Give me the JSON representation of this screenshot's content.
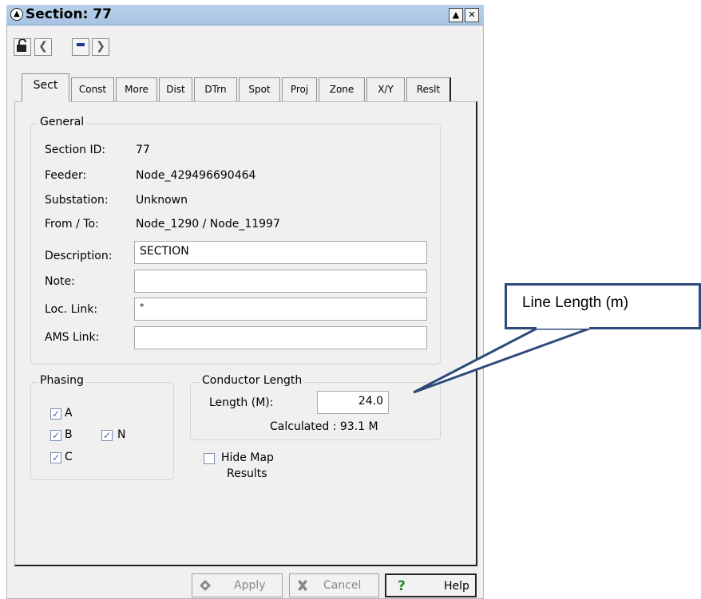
{
  "window": {
    "title": "Section: 77"
  },
  "tabs": [
    {
      "label": "Sect"
    },
    {
      "label": "Const"
    },
    {
      "label": "More"
    },
    {
      "label": "Dist"
    },
    {
      "label": "DTrn"
    },
    {
      "label": "Spot"
    },
    {
      "label": "Proj"
    },
    {
      "label": "Zone"
    },
    {
      "label": "X/Y"
    },
    {
      "label": "Reslt"
    }
  ],
  "general": {
    "title": "General",
    "section_id_label": "Section ID:",
    "section_id_value": "77",
    "feeder_label": "Feeder:",
    "feeder_value": "Node_429496690464",
    "substation_label": "Substation:",
    "substation_value": "Unknown",
    "from_to_label": "From / To:",
    "from_to_value": "Node_1290 / Node_11997",
    "description_label": "Description:",
    "description_value": "SECTION",
    "note_label": "Note:",
    "note_value": "",
    "loc_link_label": "Loc. Link:",
    "loc_link_value": "*",
    "ams_link_label": "AMS Link:",
    "ams_link_value": ""
  },
  "phasing": {
    "title": "Phasing",
    "a_label": "A",
    "a_checked": true,
    "b_label": "B",
    "b_checked": true,
    "n_label": "N",
    "n_checked": true,
    "c_label": "C",
    "c_checked": true
  },
  "conductor": {
    "title": "Conductor Length",
    "length_label": "Length (M):",
    "length_value": "24.0",
    "calculated": "Calculated : 93.1 M"
  },
  "hide_map": {
    "label_line1": "Hide Map",
    "label_line2": "Results",
    "checked": false
  },
  "buttons": {
    "apply": "Apply",
    "cancel": "Cancel",
    "help": "Help"
  },
  "callout": {
    "text": "Line Length (m)"
  },
  "colors": {
    "titlebar": "#b9d1ea",
    "callout_border": "#2e4a7a",
    "window_bg": "#f0f0f0"
  }
}
